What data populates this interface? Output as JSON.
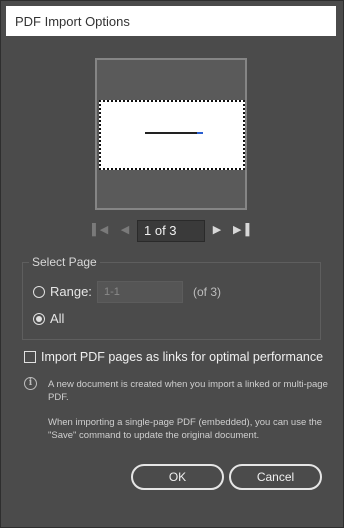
{
  "window": {
    "title": "PDF Import Options"
  },
  "nav": {
    "page_value": "1 of 3",
    "first_icon": "first-page-icon",
    "prev_icon": "previous-page-icon",
    "next_icon": "next-page-icon",
    "last_icon": "last-page-icon"
  },
  "select_page": {
    "legend": "Select Page",
    "range_label": "Range:",
    "range_placeholder": "1-1",
    "range_of": "(of 3)",
    "all_label": "All",
    "selected": "All"
  },
  "import_links": {
    "label": "Import PDF pages as links for optimal performance",
    "checked": false
  },
  "info": {
    "icon": "info-icon",
    "text1": "A new document is created when you import a linked or multi-page PDF.",
    "text2": "When importing a single-page PDF (embedded), you can use the \"Save\" command to update the original document."
  },
  "buttons": {
    "ok": "OK",
    "cancel": "Cancel"
  }
}
